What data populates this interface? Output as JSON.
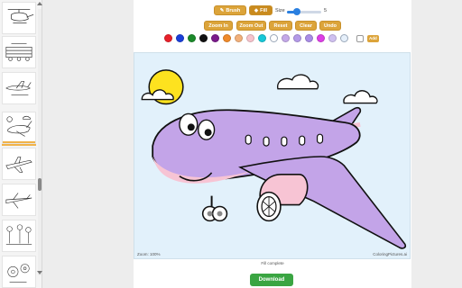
{
  "toolbar": {
    "brush_label": "Brush",
    "fill_label": "Fill",
    "size_label": "Size",
    "size_value": "5",
    "size_fraction": 0.3,
    "zoom_in_label": "Zoom In",
    "zoom_out_label": "Zoom Out",
    "reset_label": "Reset",
    "clear_label": "Clear",
    "undo_label": "Undo",
    "active_tool": "fill",
    "brush_icon": "brush-icon",
    "fill_icon": "paint-bucket-icon"
  },
  "palette": {
    "colors": [
      "#e8202a",
      "#1a3fd9",
      "#1b8a2a",
      "#111111",
      "#7a1a8a",
      "#f08a2a",
      "#f2b07a",
      "#f7c3cc",
      "#16c8d8",
      "#ffffff",
      "#c4a8e8",
      "#b49ae8",
      "#a98ce6",
      "#dd3ee6",
      "#cfc0f0",
      "#e6f0fb"
    ],
    "add_label": "Add"
  },
  "canvas": {
    "zoom_text": "Zoom: 100%",
    "credit_text": "ColoringPictures.ai",
    "status_text": "Fill complete",
    "background_color": "#e2f1fb",
    "plane_color": "#c3a4e8",
    "nose_color": "#f7c4d4",
    "sun_color": "#fde21f"
  },
  "download_label": "Download",
  "sidebar": {
    "selected_index": 3
  }
}
